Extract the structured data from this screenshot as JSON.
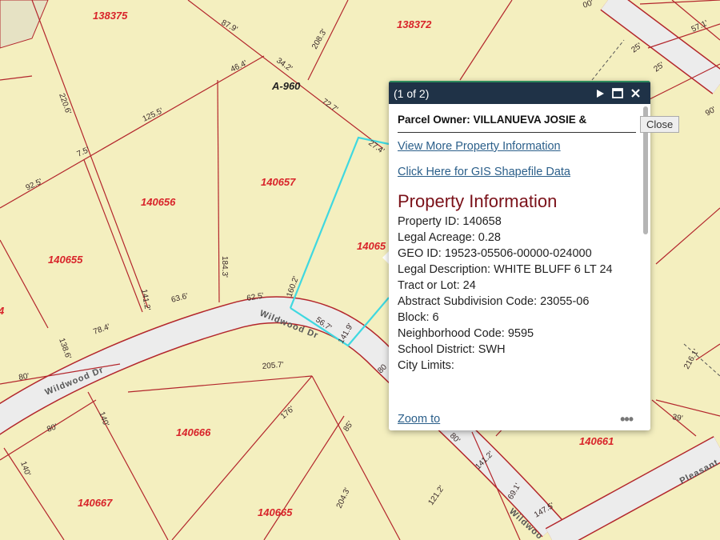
{
  "map": {
    "parcel_ids": [
      "138375",
      "138372",
      "140657",
      "140656",
      "140655",
      "140666",
      "140667",
      "140665",
      "140661",
      "14065",
      "4"
    ],
    "abstract_label": "A-960",
    "dimensions": [
      "87.9'",
      "34.2'",
      "208.3'",
      "46.4'",
      "72.7'",
      "220.6'",
      "125.5'",
      "7.5'",
      "92.5'",
      "27.4'",
      "184.3'",
      "160.2'",
      "63.6'",
      "62.5'",
      "141.2'",
      "78.4'",
      "138.6'",
      "80'",
      "56.7'",
      "141.9'",
      "205.7'",
      "80'",
      "140'",
      "176'",
      "85'",
      "140'",
      "204.3'",
      "121.2'",
      "80'",
      "141.2'",
      "69.1'",
      "147.5'",
      "39'",
      "216.1'",
      "25'",
      "25'",
      "57.1'",
      "90'",
      "00'",
      "80",
      "80"
    ],
    "road_labels": [
      "Wildwood Dr",
      "Wildwood Dr",
      "Wildwoo",
      "Pleasant"
    ],
    "colors": {
      "background": "#f4efbf",
      "parcel_line": "#b3262c",
      "road": "#ececec",
      "selected_parcel": "#3fd8e0",
      "label": "#d8242a"
    }
  },
  "popup": {
    "count_label": "(1 of 2)",
    "owner_label": "Parcel Owner: VILLANUEVA JOSIE &",
    "link_more_info": "View More Property Information",
    "link_gis": "Click Here for GIS Shapefile Data",
    "section_title": "Property Information",
    "fields": [
      "Property ID: 140658",
      "Legal Acreage: 0.28",
      "GEO ID: 19523-05506-00000-024000",
      "Legal Description: WHITE BLUFF 6 LT 24",
      "Tract or Lot: 24",
      "Abstract Subdivision Code: 23055-06",
      "Block: 6",
      "Neighborhood Code: 9595",
      "School District: SWH",
      "City Limits:"
    ],
    "zoom_to": "Zoom to",
    "more": "•••",
    "header_icons": [
      "next-arrow-icon",
      "maximize-icon",
      "close-icon"
    ],
    "header_color": "#1f3247",
    "title_color": "#7a1018"
  },
  "tooltip": {
    "close": "Close"
  }
}
